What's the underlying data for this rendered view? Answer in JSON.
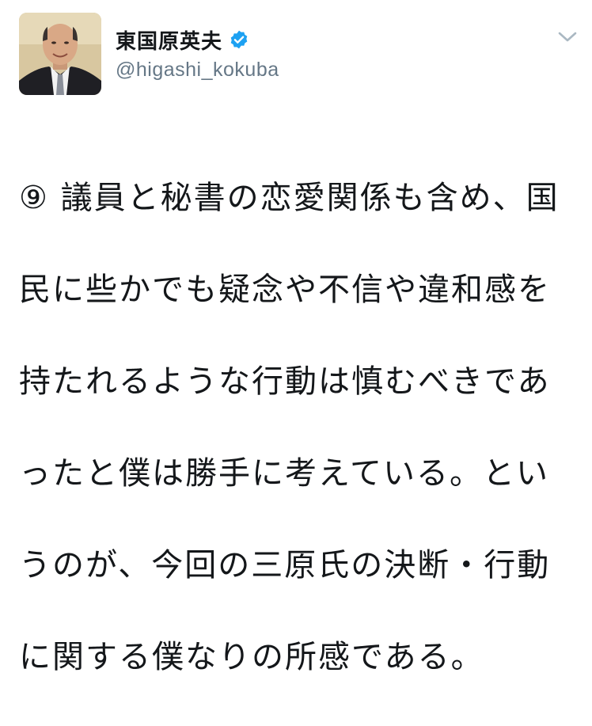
{
  "user": {
    "display_name": "東国原英夫",
    "handle": "@higashi_kokuba",
    "verified": true,
    "avatar_alt_icon": "profile-photo"
  },
  "icons": {
    "verified": "verified-badge-icon",
    "menu": "chevron-down-icon"
  },
  "colors": {
    "verified_blue": "#1da1f2",
    "text": "#14171a",
    "secondary_text": "#657786",
    "chevron": "#aab8c2"
  },
  "tweet": {
    "lines": [
      "⑨ 議員と秘書の恋愛関係も含め、国",
      "民に些かでも疑念や不信や違和感を",
      "持たれるような行動は慎むべきであ",
      "ったと僕は勝手に考えている。とい",
      "うのが、今回の三原氏の決断・行動",
      "に関する僕なりの所感である。"
    ]
  }
}
